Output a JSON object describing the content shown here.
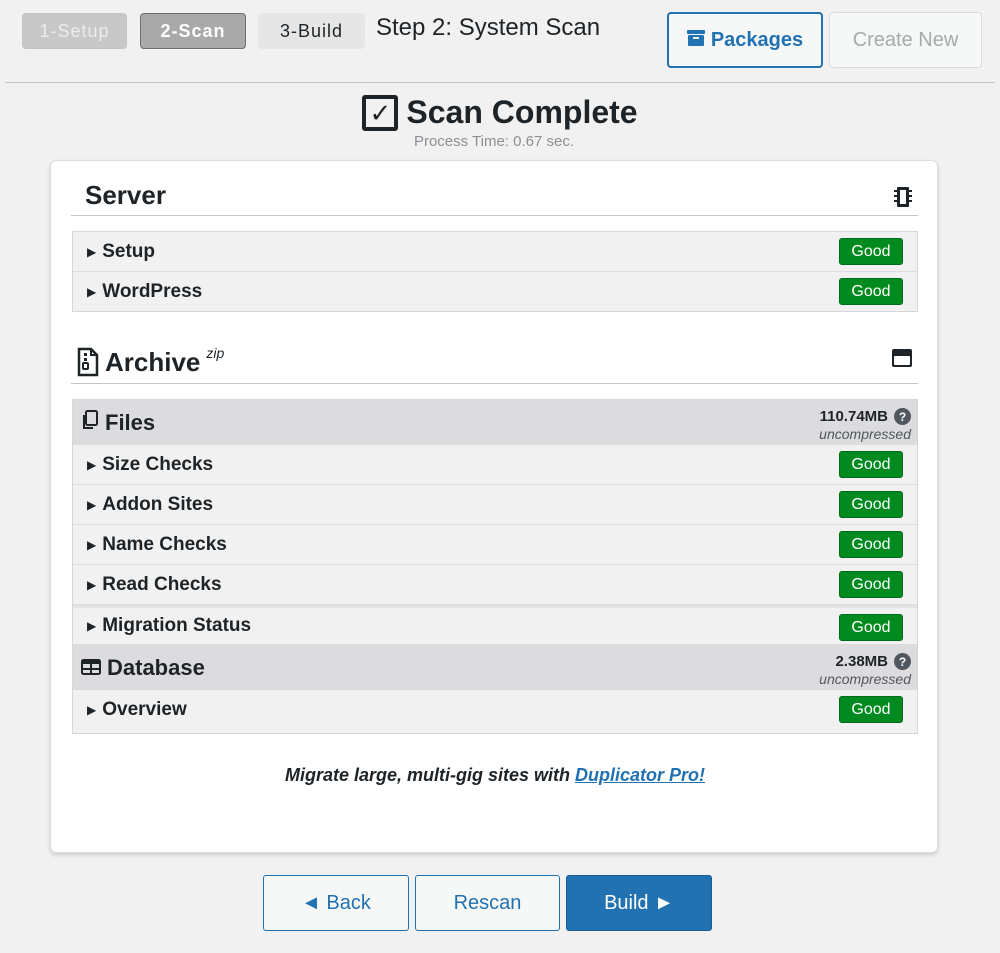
{
  "steps": [
    {
      "label": "1-Setup"
    },
    {
      "label": "2-Scan"
    },
    {
      "label": "3-Build"
    }
  ],
  "page_title": "Step 2: System Scan",
  "header_buttons": {
    "packages": "Packages",
    "create_new": "Create New"
  },
  "scan": {
    "title": "Scan Complete",
    "process_time": "Process Time: 0.67 sec."
  },
  "server": {
    "title": "Server",
    "rows": [
      {
        "label": "Setup",
        "status": "Good"
      },
      {
        "label": "WordPress",
        "status": "Good"
      }
    ]
  },
  "archive": {
    "title": "Archive",
    "suffix": "zip",
    "files": {
      "title": "Files",
      "size": "110.74MB",
      "size_note": "uncompressed",
      "rows": [
        {
          "label": "Size Checks",
          "status": "Good"
        },
        {
          "label": "Addon Sites",
          "status": "Good"
        },
        {
          "label": "Name Checks",
          "status": "Good"
        },
        {
          "label": "Read Checks",
          "status": "Good"
        },
        {
          "label": "Migration Status",
          "status": "Good"
        }
      ]
    },
    "database": {
      "title": "Database",
      "size": "2.38MB",
      "size_note": "uncompressed",
      "rows": [
        {
          "label": "Overview",
          "status": "Good"
        }
      ]
    }
  },
  "promo": {
    "text": "Migrate large, multi-gig sites with ",
    "link": "Duplicator Pro!"
  },
  "footer_buttons": {
    "back": "◄ Back",
    "rescan": "Rescan",
    "build": "Build ►"
  },
  "colors": {
    "accent": "#2271b1",
    "good": "#008a20"
  }
}
